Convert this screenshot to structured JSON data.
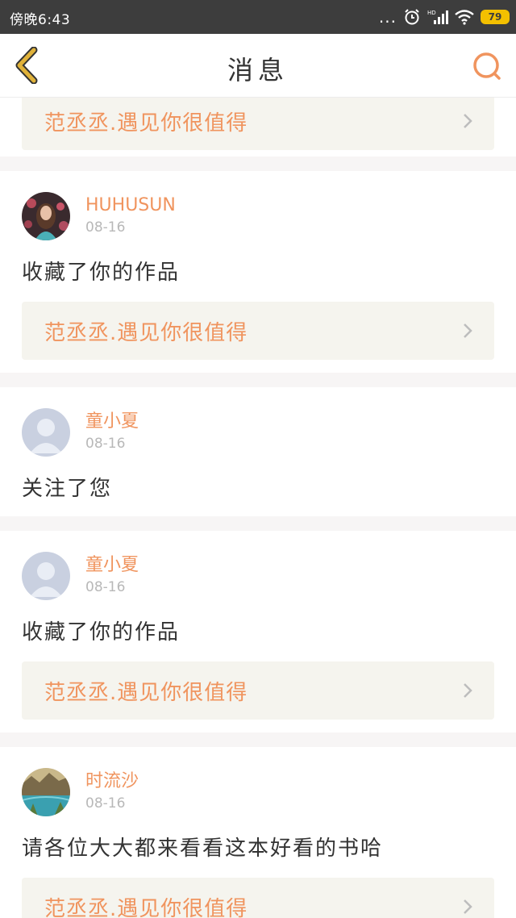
{
  "status_bar": {
    "time": "傍晚6:43",
    "dots": "...",
    "battery": "79"
  },
  "header": {
    "title": "消息",
    "back_icon": "chevron-left-icon",
    "search_icon": "search-icon"
  },
  "colors": {
    "accent": "#f0945e",
    "back": "#e0b23a",
    "link_bg": "#f5f4ee"
  },
  "messages": [
    {
      "work_title": "范丞丞.遇见你很值得"
    },
    {
      "username": "HUHUSUN",
      "date": "08-16",
      "action": "收藏了你的作品",
      "work_title": "范丞丞.遇见你很值得"
    },
    {
      "username": "童小夏",
      "date": "08-16",
      "action": "关注了您"
    },
    {
      "username": "童小夏",
      "date": "08-16",
      "action": "收藏了你的作品",
      "work_title": "范丞丞.遇见你很值得"
    },
    {
      "username": "时流沙",
      "date": "08-16",
      "action": "请各位大大都来看看这本好看的书哈",
      "work_title": "范丞丞.遇见你很值得"
    }
  ]
}
